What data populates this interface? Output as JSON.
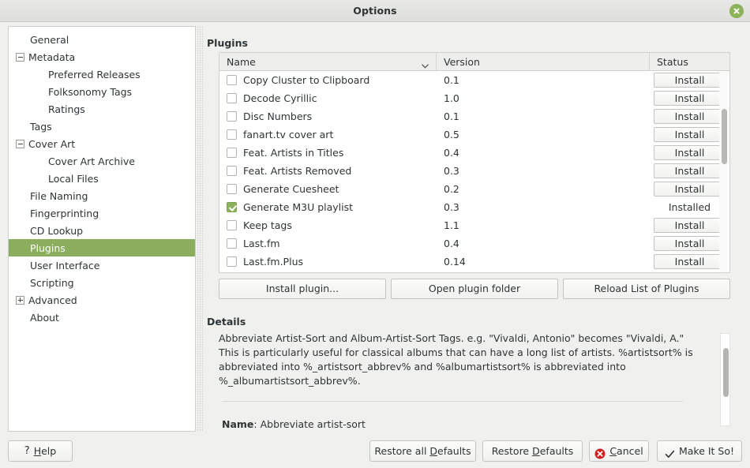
{
  "window": {
    "title": "Options",
    "close_icon": "close-icon",
    "accent_green": "#8aad5e",
    "background": "#f0f0ef"
  },
  "sidebar": {
    "items": [
      {
        "label": "General",
        "level": 0,
        "expander": null,
        "selected": false
      },
      {
        "label": "Metadata",
        "level": 0,
        "expander": "minus",
        "selected": false
      },
      {
        "label": "Preferred Releases",
        "level": 1,
        "expander": null,
        "selected": false
      },
      {
        "label": "Folksonomy Tags",
        "level": 1,
        "expander": null,
        "selected": false
      },
      {
        "label": "Ratings",
        "level": 1,
        "expander": null,
        "selected": false
      },
      {
        "label": "Tags",
        "level": 0,
        "expander": null,
        "selected": false
      },
      {
        "label": "Cover Art",
        "level": 0,
        "expander": "minus",
        "selected": false
      },
      {
        "label": "Cover Art Archive",
        "level": 1,
        "expander": null,
        "selected": false
      },
      {
        "label": "Local Files",
        "level": 1,
        "expander": null,
        "selected": false
      },
      {
        "label": "File Naming",
        "level": 0,
        "expander": null,
        "selected": false
      },
      {
        "label": "Fingerprinting",
        "level": 0,
        "expander": null,
        "selected": false
      },
      {
        "label": "CD Lookup",
        "level": 0,
        "expander": null,
        "selected": false
      },
      {
        "label": "Plugins",
        "level": 0,
        "expander": null,
        "selected": true
      },
      {
        "label": "User Interface",
        "level": 0,
        "expander": null,
        "selected": false
      },
      {
        "label": "Scripting",
        "level": 0,
        "expander": null,
        "selected": false
      },
      {
        "label": "Advanced",
        "level": 0,
        "expander": "plus",
        "selected": false
      },
      {
        "label": "About",
        "level": 0,
        "expander": null,
        "selected": false
      }
    ]
  },
  "plugins": {
    "section_title": "Plugins",
    "columns": [
      "Name",
      "Version",
      "Status"
    ],
    "sort_indicator": "chevron-down-icon",
    "install_label": "Install",
    "installed_label": "Installed",
    "rows": [
      {
        "name": "Copy Cluster to Clipboard",
        "version": "0.1",
        "checked": false,
        "installed": false
      },
      {
        "name": "Decode Cyrillic",
        "version": "1.0",
        "checked": false,
        "installed": false
      },
      {
        "name": "Disc Numbers",
        "version": "0.1",
        "checked": false,
        "installed": false
      },
      {
        "name": "fanart.tv cover art",
        "version": "0.5",
        "checked": false,
        "installed": false
      },
      {
        "name": "Feat. Artists in Titles",
        "version": "0.4",
        "checked": false,
        "installed": false
      },
      {
        "name": "Feat. Artists Removed",
        "version": "0.3",
        "checked": false,
        "installed": false
      },
      {
        "name": "Generate Cuesheet",
        "version": "0.2",
        "checked": false,
        "installed": false
      },
      {
        "name": "Generate M3U playlist",
        "version": "0.3",
        "checked": true,
        "installed": true
      },
      {
        "name": "Keep tags",
        "version": "1.1",
        "checked": false,
        "installed": false
      },
      {
        "name": "Last.fm",
        "version": "0.4",
        "checked": false,
        "installed": false
      },
      {
        "name": "Last.fm.Plus",
        "version": "0.14",
        "checked": false,
        "installed": false
      }
    ],
    "actions": [
      {
        "label": "Install plugin..."
      },
      {
        "label": "Open plugin folder"
      },
      {
        "label": "Reload List of Plugins"
      }
    ]
  },
  "details": {
    "section_title": "Details",
    "description": "Abbreviate Artist-Sort and Album-Artist-Sort Tags. e.g. \"Vivaldi, Antonio\" becomes \"Vivaldi, A.\" This is particularly useful for classical albums that can have a long list of artists. %artistsort% is abbreviated into %_artistsort_abbrev% and %albumartistsort% is abbreviated into %_albumartistsort_abbrev%.",
    "name_label": "Name",
    "name_value": "Abbreviate artist-sort"
  },
  "footer": {
    "help": {
      "prefix": "",
      "mnemonic": "H",
      "rest": "elp",
      "icon": "question-mark-icon"
    },
    "restore_all": {
      "pre": "Restore all ",
      "mnemonic": "D",
      "post": "efaults"
    },
    "restore": {
      "pre": "Restore ",
      "mnemonic": "D",
      "post": "efaults"
    },
    "cancel": {
      "pre": "",
      "mnemonic": "C",
      "post": "ancel",
      "icon": "cancel-icon"
    },
    "make_it_so": {
      "label": "Make It So!",
      "icon": "check-icon"
    }
  }
}
